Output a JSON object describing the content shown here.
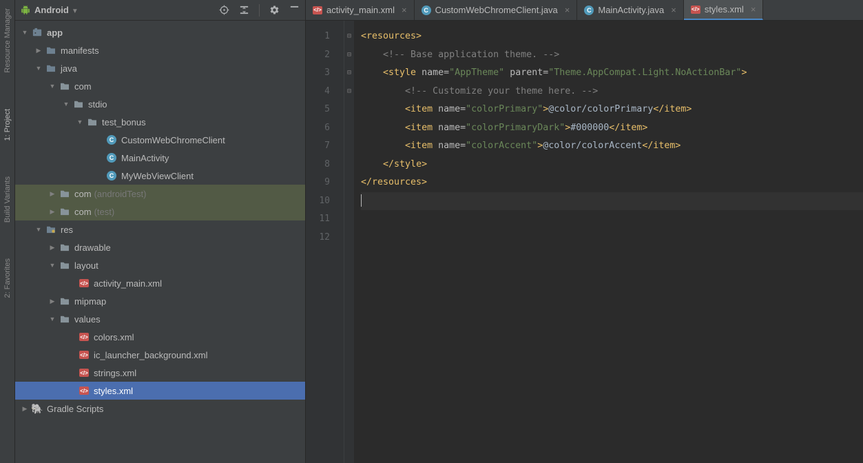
{
  "rail": {
    "tabs": [
      "Resource Manager",
      "1: Project",
      "Build Variants",
      "2: Favorites"
    ],
    "active_index": 1
  },
  "sidebar": {
    "title": "Android",
    "tree": {
      "app": "app",
      "manifests": "manifests",
      "java": "java",
      "com1": "com",
      "stdio": "stdio",
      "test_bonus": "test_bonus",
      "cls_customweb": "CustomWebChromeClient",
      "cls_mainactivity": "MainActivity",
      "cls_mywebview": "MyWebViewClient",
      "com2": "com",
      "com2_hint": "(androidTest)",
      "com3": "com",
      "com3_hint": "(test)",
      "res": "res",
      "drawable": "drawable",
      "layout": "layout",
      "activity_main": "activity_main.xml",
      "mipmap": "mipmap",
      "values": "values",
      "colors": "colors.xml",
      "ic_launcher_bg": "ic_launcher_background.xml",
      "strings": "strings.xml",
      "styles": "styles.xml",
      "gradle": "Gradle Scripts"
    }
  },
  "tabs": [
    {
      "icon": "xml",
      "label": "activity_main.xml",
      "close": true
    },
    {
      "icon": "java",
      "label": "CustomWebChromeClient.java",
      "close": true
    },
    {
      "icon": "java",
      "label": "MainActivity.java",
      "close": true
    },
    {
      "icon": "xml",
      "label": "styles.xml",
      "close": true,
      "active": true
    }
  ],
  "editor": {
    "line_count": 12,
    "fold_marks": {
      "1": "⊟",
      "4": "⊟",
      "9": "⊟",
      "11": "⊟"
    },
    "code": {
      "l1": "<resources>",
      "l3_comment": "<!-- Base application theme. -->",
      "l4_open": "<style",
      "l4_attr1": "name=",
      "l4_val1": "\"AppTheme\"",
      "l4_attr2": "parent=",
      "l4_val2": "\"Theme.AppCompat.Light.NoActionBar\"",
      "l4_close": ">",
      "l5_comment": "<!-- Customize your theme here. -->",
      "l6_open": "<item",
      "l6_attr": "name=",
      "l6_val": "\"colorPrimary\"",
      "l6_mid": ">",
      "l6_text": "@color/colorPrimary",
      "l6_close": "</item>",
      "l7_open": "<item",
      "l7_attr": "name=",
      "l7_val": "\"colorPrimaryDark\"",
      "l7_mid": ">",
      "l7_text": "#000000",
      "l7_close": "</item>",
      "l8_open": "<item",
      "l8_attr": "name=",
      "l8_val": "\"colorAccent\"",
      "l8_mid": ">",
      "l8_text": "@color/colorAccent",
      "l8_close": "</item>",
      "l9": "</style>",
      "l11": "</resources>"
    }
  }
}
